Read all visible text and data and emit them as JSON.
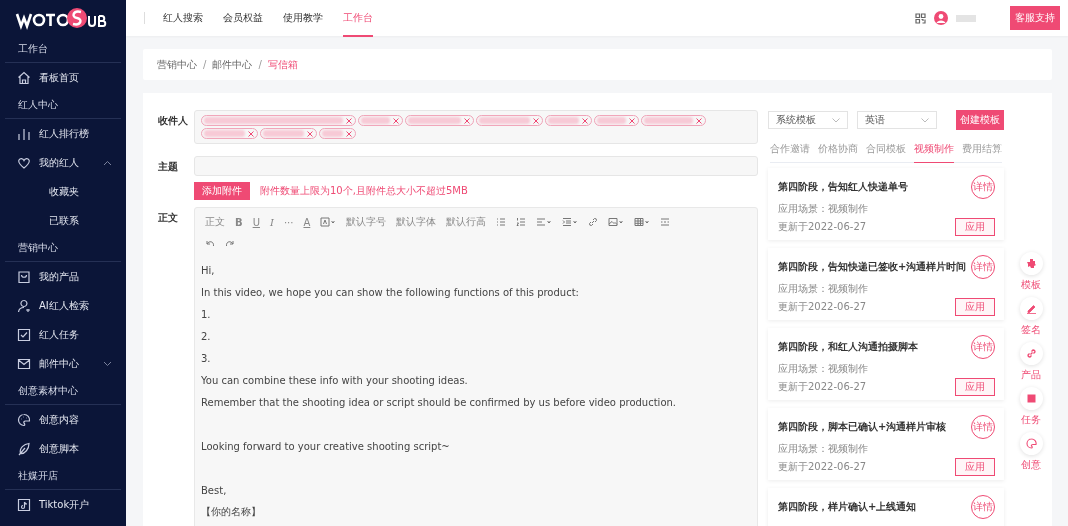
{
  "sidebar": {
    "sections": [
      {
        "title": "工作台",
        "items": [
          {
            "label": "看板首页"
          }
        ]
      },
      {
        "title": "红人中心",
        "items": [
          {
            "label": "红人排行榜"
          },
          {
            "label": "我的红人",
            "expanded": true,
            "children": [
              {
                "label": "收藏夹"
              },
              {
                "label": "已联系"
              }
            ]
          }
        ]
      },
      {
        "title": "营销中心",
        "items": [
          {
            "label": "我的产品"
          },
          {
            "label": "AI红人检索"
          },
          {
            "label": "红人任务"
          },
          {
            "label": "邮件中心",
            "expanded": false
          }
        ]
      },
      {
        "title": "创意素材中心",
        "items": [
          {
            "label": "创意内容"
          },
          {
            "label": "创意脚本"
          }
        ]
      },
      {
        "title": "社媒开店",
        "items": [
          {
            "label": "Tiktok开户"
          }
        ]
      }
    ]
  },
  "top_nav": {
    "tabs": [
      {
        "label": "红人搜索",
        "selected": false
      },
      {
        "label": "会员权益",
        "selected": false
      },
      {
        "label": "使用教学",
        "selected": false
      },
      {
        "label": "工作台",
        "selected": true
      }
    ],
    "support_button": "客服支持"
  },
  "breadcrumb": [
    {
      "kind": "link",
      "label": "营销中心"
    },
    {
      "kind": "separator",
      "label": "/"
    },
    {
      "kind": "link",
      "label": "邮件中心"
    },
    {
      "kind": "separator",
      "label": "/"
    },
    {
      "kind": "current",
      "label": "写信箱"
    }
  ],
  "form": {
    "recipients_label": "收件人",
    "recipients": [
      {
        "removable": true
      },
      {
        "removable": true
      },
      {
        "removable": true
      },
      {
        "removable": true
      },
      {
        "removable": true
      },
      {
        "removable": true
      },
      {
        "removable": true
      },
      {
        "removable": true
      },
      {
        "removable": true
      },
      {
        "removable": true
      }
    ],
    "subject_label": "主题",
    "attach_button": "添加附件",
    "attach_hint": "附件数量上限为10个,且附件总大小不超过5MB",
    "body_label": "正文",
    "toolbar_texts": [
      "正文",
      "B",
      "U",
      "I",
      "···",
      "A",
      "默认字号",
      "默认字体",
      "默认行高"
    ],
    "body": [
      {
        "lines": [
          "Hi,",
          "In this video, we hope you can show the following functions of this product:",
          "1.",
          "2.",
          "3.",
          "You can combine these info with your shooting ideas.",
          "Remember that the shooting idea or script should be confirmed by us before video production."
        ]
      },
      {
        "lines": [
          "Looking forward to your creative shooting script~"
        ]
      },
      {
        "lines": [
          "Best,",
          "【你的名称】"
        ]
      }
    ]
  },
  "templates": {
    "type_select": "系统模板",
    "language_select": "英语",
    "create_button": "创建模板",
    "tabs": [
      {
        "label": "合作邀请",
        "selected": false
      },
      {
        "label": "价格协商",
        "selected": false
      },
      {
        "label": "合同模板",
        "selected": false
      },
      {
        "label": "视频制作",
        "selected": true
      },
      {
        "label": "费用结算",
        "selected": false
      }
    ],
    "cards": [
      {
        "title": "第四阶段，告知红人快递单号",
        "badge": "详情",
        "scene": "应用场景：视频制作",
        "updated": "更新于2022-06-27",
        "button": "应用"
      },
      {
        "title": "第四阶段，告知快递已签收+沟通样片时间",
        "badge": "详情",
        "scene": "应用场景：视频制作",
        "updated": "更新于2022-06-27",
        "button": "应用"
      },
      {
        "title": "第四阶段，和红人沟通拍摄脚本",
        "badge": "详情",
        "scene": "应用场景：视频制作",
        "updated": "更新于2022-06-27",
        "button": "应用"
      },
      {
        "title": "第四阶段，脚本已确认+沟通样片审核",
        "badge": "详情",
        "scene": "应用场景：视频制作",
        "updated": "更新于2022-06-27",
        "button": "应用"
      },
      {
        "title": "第四阶段，样片确认+上线通知",
        "badge": "详情"
      }
    ]
  },
  "float_buttons": [
    {
      "label": "模板"
    },
    {
      "label": "签名"
    },
    {
      "label": "产品"
    },
    {
      "label": "任务"
    },
    {
      "label": "创意"
    }
  ]
}
